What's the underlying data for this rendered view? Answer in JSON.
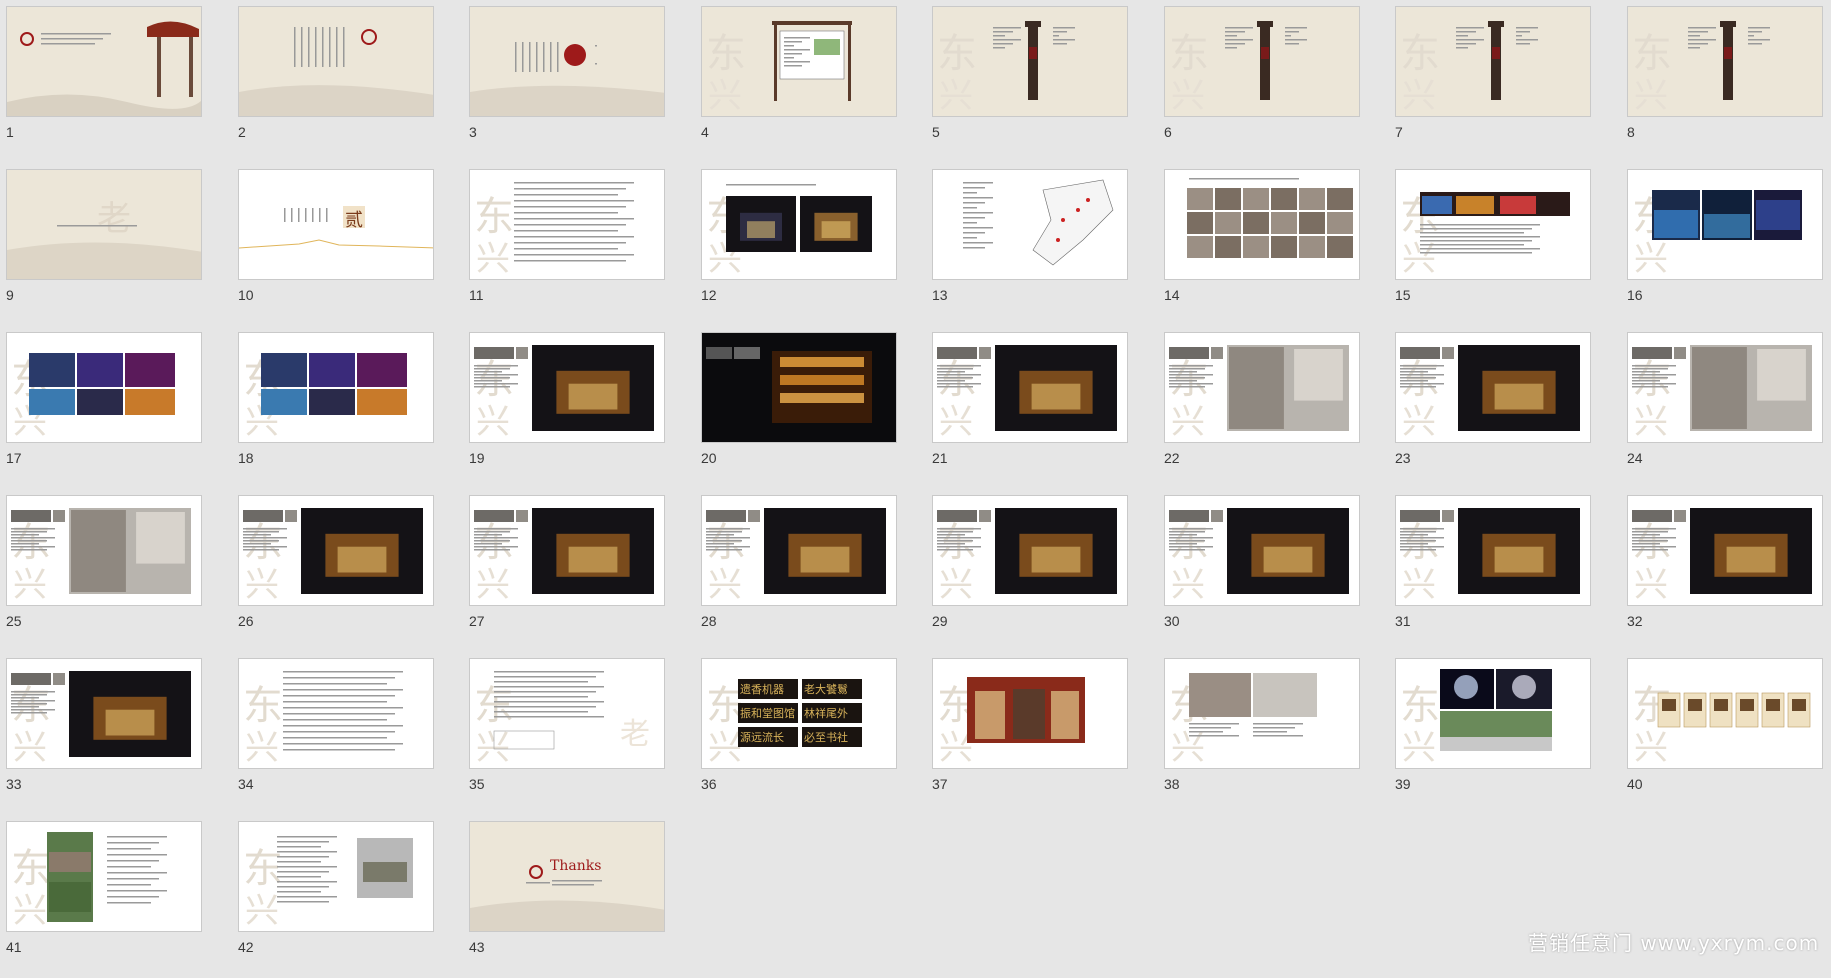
{
  "slides": [
    {
      "n": "1",
      "kind": "cover"
    },
    {
      "n": "2",
      "kind": "beige-text"
    },
    {
      "n": "3",
      "kind": "beige-seal"
    },
    {
      "n": "4",
      "kind": "sign-board"
    },
    {
      "n": "5",
      "kind": "sign-post"
    },
    {
      "n": "6",
      "kind": "sign-post"
    },
    {
      "n": "7",
      "kind": "sign-post"
    },
    {
      "n": "8",
      "kind": "sign-post"
    },
    {
      "n": "9",
      "kind": "beige-blank"
    },
    {
      "n": "10",
      "kind": "chapter"
    },
    {
      "n": "11",
      "kind": "text"
    },
    {
      "n": "12",
      "kind": "photo2-dark"
    },
    {
      "n": "13",
      "kind": "map"
    },
    {
      "n": "14",
      "kind": "photo-grid"
    },
    {
      "n": "15",
      "kind": "photo-strip"
    },
    {
      "n": "16",
      "kind": "photo-blue"
    },
    {
      "n": "17",
      "kind": "photo-collage"
    },
    {
      "n": "18",
      "kind": "photo-collage"
    },
    {
      "n": "19",
      "kind": "night-side"
    },
    {
      "n": "20",
      "kind": "full-dark"
    },
    {
      "n": "21",
      "kind": "night-side"
    },
    {
      "n": "22",
      "kind": "day-side"
    },
    {
      "n": "23",
      "kind": "night-side"
    },
    {
      "n": "24",
      "kind": "day-side"
    },
    {
      "n": "25",
      "kind": "day-side"
    },
    {
      "n": "26",
      "kind": "night-side"
    },
    {
      "n": "27",
      "kind": "night-side"
    },
    {
      "n": "28",
      "kind": "night-side"
    },
    {
      "n": "29",
      "kind": "night-side"
    },
    {
      "n": "30",
      "kind": "night-side"
    },
    {
      "n": "31",
      "kind": "night-side"
    },
    {
      "n": "32",
      "kind": "night-side"
    },
    {
      "n": "33",
      "kind": "night-side"
    },
    {
      "n": "34",
      "kind": "text"
    },
    {
      "n": "35",
      "kind": "text-table"
    },
    {
      "n": "36",
      "kind": "plaques"
    },
    {
      "n": "37",
      "kind": "shopfront"
    },
    {
      "n": "38",
      "kind": "two-photos"
    },
    {
      "n": "39",
      "kind": "trees"
    },
    {
      "n": "40",
      "kind": "icons"
    },
    {
      "n": "41",
      "kind": "garden"
    },
    {
      "n": "42",
      "kind": "text-photo"
    },
    {
      "n": "43",
      "kind": "thanks"
    }
  ],
  "thanks_text": "Thanks",
  "watermark": "营销任意门 www.yxrym.com",
  "plaque_texts": [
    "遗香机器",
    "老大饕鬄",
    "振和堂图馆",
    "林祥尾外",
    "源远流长",
    "必至书社"
  ],
  "chapter_char": "贰",
  "colors": {
    "beige": "#ece6d8",
    "brand_red": "#9e1a1a",
    "gold": "#e0a84a"
  }
}
